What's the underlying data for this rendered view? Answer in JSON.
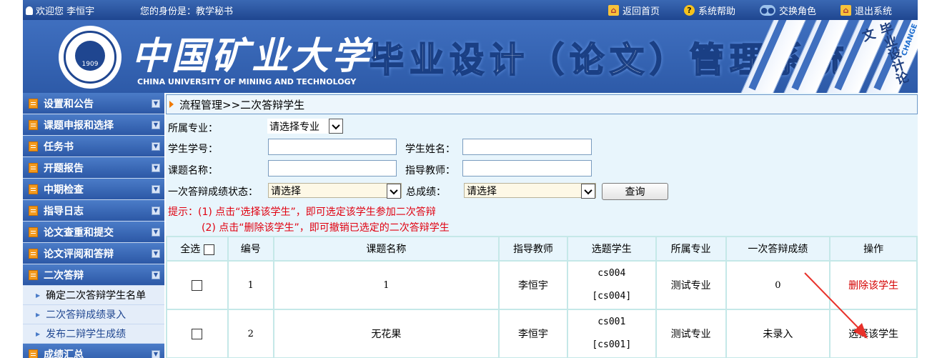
{
  "topbar": {
    "welcome": "欢迎您 李恒宇",
    "role": "您的身份是：教学秘书",
    "nav": [
      {
        "label": "返回首页",
        "icon": "home-icon"
      },
      {
        "label": "系统帮助",
        "icon": "help-icon"
      },
      {
        "label": "交换角色",
        "icon": "users-icon"
      },
      {
        "label": "退出系统",
        "icon": "exit-home-icon"
      }
    ]
  },
  "banner": {
    "university_cn": "中国矿业大学",
    "university_en": "CHINA UNIVERSITY OF MINING AND TECHNOLOGY",
    "system_title": "毕业设计（论文）管理系统",
    "book_label": "毕业设计论文",
    "book_brand": "CHANGE",
    "emblem_year": "1909"
  },
  "sidebar": {
    "menus": [
      {
        "label": "设置和公告"
      },
      {
        "label": "课题申报和选择"
      },
      {
        "label": "任务书"
      },
      {
        "label": "开题报告"
      },
      {
        "label": "中期检查"
      },
      {
        "label": "指导日志"
      },
      {
        "label": "论文查重和提交"
      },
      {
        "label": "论文评阅和答辩"
      },
      {
        "label": "二次答辩"
      }
    ],
    "submenus": [
      {
        "label": "确定二次答辩学生名单"
      },
      {
        "label": "二次答辩成绩录入"
      },
      {
        "label": "发布二辩学生成绩"
      }
    ],
    "last_menu": "成绩汇总"
  },
  "breadcrumb": "流程管理>>二次答辩学生",
  "form": {
    "major_label": "所属专业：",
    "major_value": "请选择专业",
    "student_id_label": "学生学号：",
    "student_name_label": "学生姓名：",
    "topic_label": "课题名称：",
    "teacher_label": "指导教师：",
    "first_defense_label": "一次答辩成绩状态：",
    "first_defense_value": "请选择",
    "total_label": "总成绩：",
    "total_value": "请选择",
    "query_button": "查询"
  },
  "tips": {
    "line1": "提示：(1) 点击“选择该学生”，即可选定该学生参加二次答辩",
    "line2": "(2) 点击“删除该学生”，即可撤销已选定的二次答辩学生"
  },
  "table": {
    "headers": [
      "全选",
      "编号",
      "课题名称",
      "指导教师",
      "选题学生",
      "所属专业",
      "一次答辩成绩",
      "操作"
    ],
    "rows": [
      {
        "no": "1",
        "topic": "1",
        "teacher": "李恒宇",
        "student": "cs004",
        "student_id": "[cs004]",
        "major": "测试专业",
        "score": "0",
        "action": "删除该学生"
      },
      {
        "no": "2",
        "topic": "无花果",
        "teacher": "李恒宇",
        "student": "cs001",
        "student_id": "[cs001]",
        "major": "测试专业",
        "score": "未录入",
        "action": "选择该学生"
      }
    ]
  },
  "colors": {
    "topbar": "#2b55a0",
    "sidebar_menu": "#3a68b3",
    "content_bg": "#e8f5fc",
    "tip_red": "#e0000f",
    "delete_link": "#d40000",
    "annotation_arrow": "#e8312a"
  }
}
